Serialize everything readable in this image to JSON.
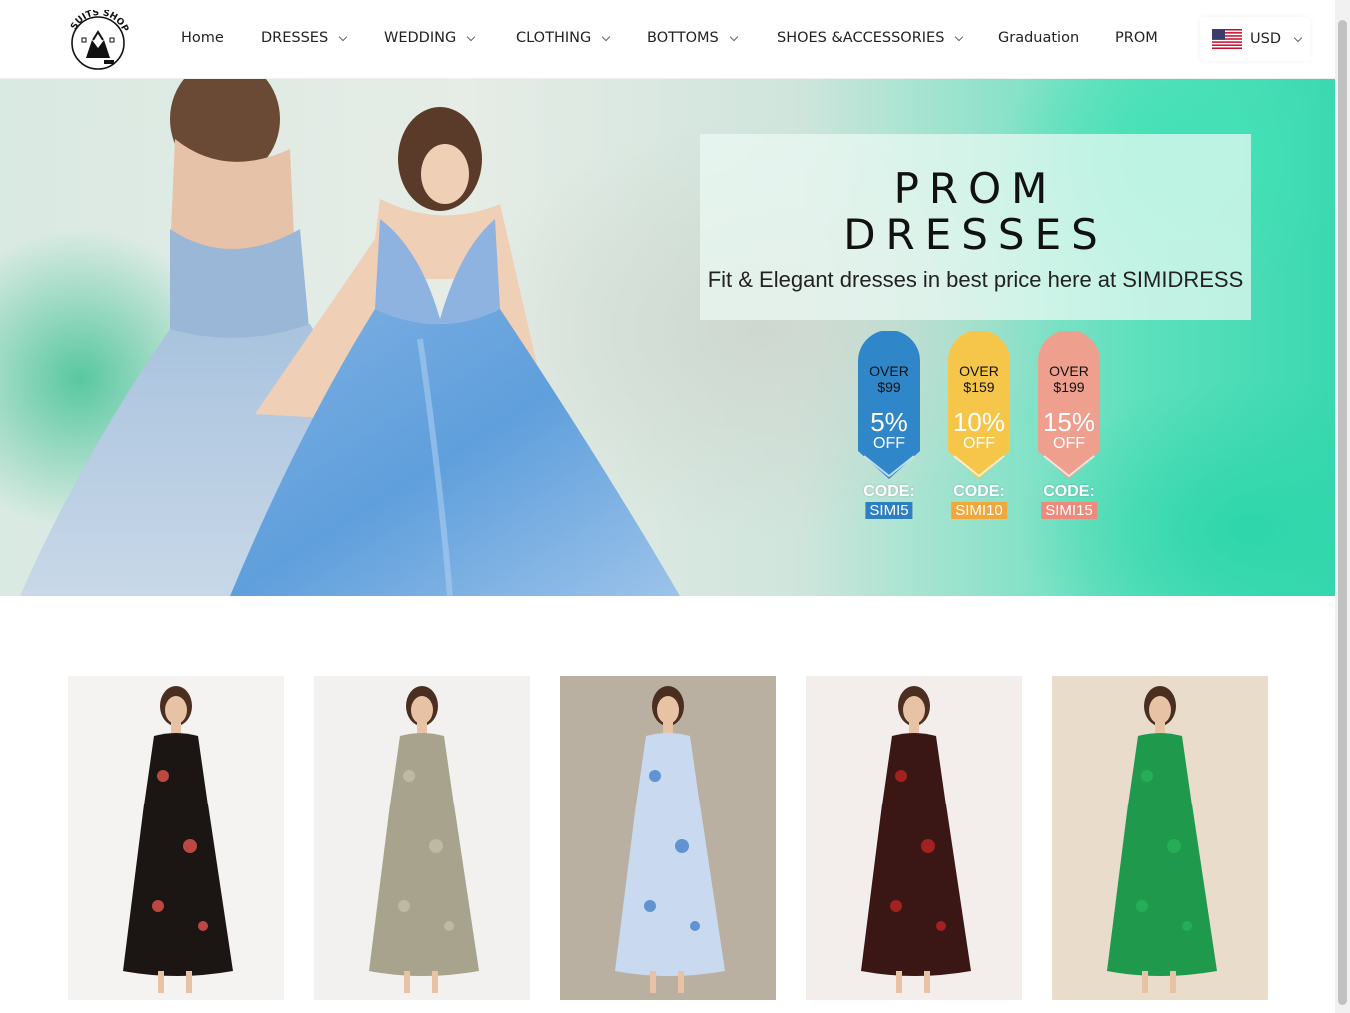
{
  "header": {
    "logo_text": "SUITS SHOP",
    "nav": [
      {
        "label": "Home",
        "has_dropdown": false
      },
      {
        "label": "DRESSES",
        "has_dropdown": true
      },
      {
        "label": "WEDDING",
        "has_dropdown": true
      },
      {
        "label": "CLOTHING",
        "has_dropdown": true
      },
      {
        "label": "BOTTOMS",
        "has_dropdown": true
      },
      {
        "label": "SHOES &ACCESSORIES",
        "has_dropdown": true
      },
      {
        "label": "Graduation",
        "has_dropdown": false
      },
      {
        "label": "PROM",
        "has_dropdown": false
      }
    ],
    "currency": {
      "label": "USD",
      "flag_icon": "us-flag-icon"
    }
  },
  "hero": {
    "title_line1": "PROM",
    "title_line2": "DRESSES",
    "subtitle": "Fit & Elegant dresses in best price here at SIMIDRESS",
    "badges": [
      {
        "over_label": "OVER",
        "threshold": "$99",
        "percent": "5%",
        "off_label": "OFF",
        "code_label": "CODE:",
        "code": "SIMI5",
        "color": "#2f86c9",
        "code_bg": "#2c7fc0"
      },
      {
        "over_label": "OVER",
        "threshold": "$159",
        "percent": "10%",
        "off_label": "OFF",
        "code_label": "CODE:",
        "code": "SIMI10",
        "color": "#f6c64a",
        "code_bg": "#f2a73a"
      },
      {
        "over_label": "OVER",
        "threshold": "$199",
        "percent": "15%",
        "off_label": "OFF",
        "code_label": "CODE:",
        "code": "SIMI15",
        "color": "#ef9f8e",
        "code_bg": "#ec8a7c"
      }
    ]
  },
  "products": [
    {
      "name": "product-floral-black-dress",
      "bg": "#f4f3f1",
      "dress_color": "#1b1614",
      "accent": "#d9514a"
    },
    {
      "name": "product-satin-olive-dress",
      "bg": "#f2f1ef",
      "dress_color": "#a7a38c",
      "accent": "#c2bea6"
    },
    {
      "name": "product-blue-floral-dress",
      "bg": "#b9b0a2",
      "dress_color": "#c9daf0",
      "accent": "#4d86cc"
    },
    {
      "name": "product-red-mesh-dress",
      "bg": "#f3eeec",
      "dress_color": "#3a1614",
      "accent": "#b52525"
    },
    {
      "name": "product-green-puff-dress",
      "bg": "#e9dccb",
      "dress_color": "#1f9a4c",
      "accent": "#27b159"
    }
  ]
}
